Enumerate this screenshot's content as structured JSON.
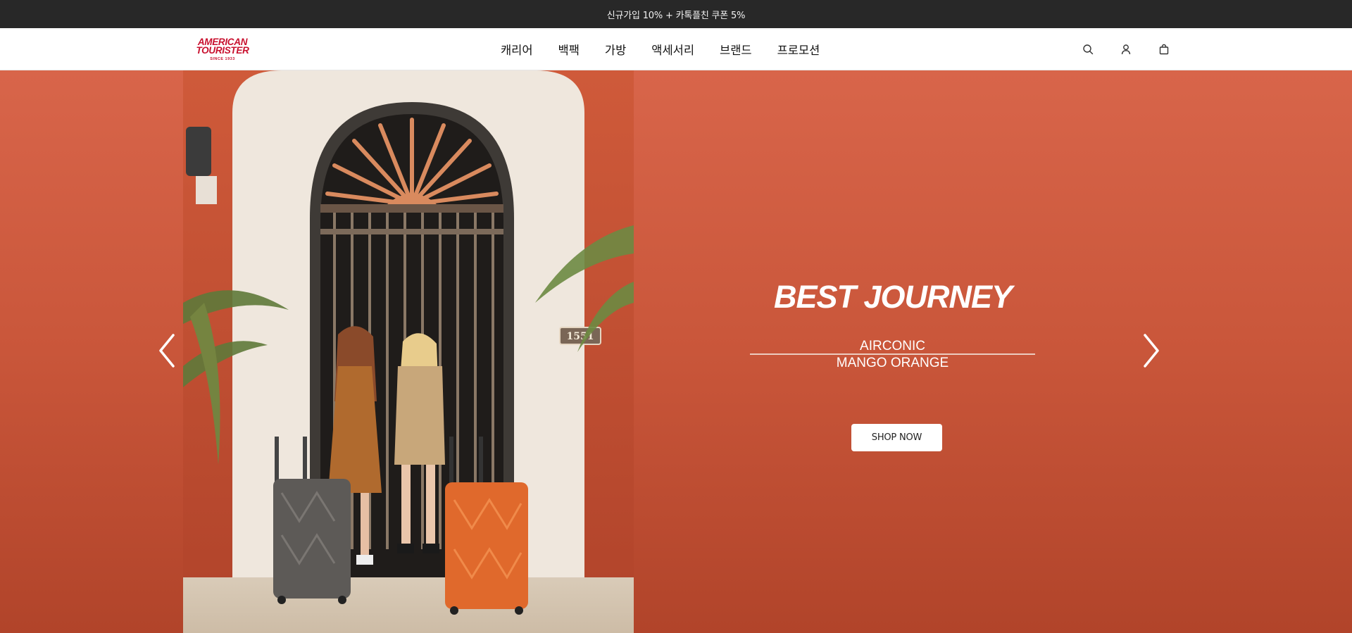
{
  "announcement": {
    "text": "신규가입 10% + 카톡플친 쿠폰 5%"
  },
  "brand": {
    "line1": "AMERICAN",
    "line2": "TOURISTER",
    "since": "SINCE 1933",
    "color": "#c8102e"
  },
  "nav": {
    "items": [
      "캐리어",
      "백팩",
      "가방",
      "액세서리",
      "브랜드",
      "프로모션"
    ]
  },
  "header_icons": [
    "search-icon",
    "user-icon",
    "shopping-bag-icon"
  ],
  "hero": {
    "title": "BEST JOURNEY",
    "subtitle_line1": "AIRCONIC",
    "subtitle_line2": "MANGO ORANGE",
    "cta": "SHOP NOW",
    "background_color": "#c9563a",
    "photo_plaque": "1551"
  },
  "carousel": {
    "prev_icon": "chevron-left-icon",
    "next_icon": "chevron-right-icon"
  }
}
